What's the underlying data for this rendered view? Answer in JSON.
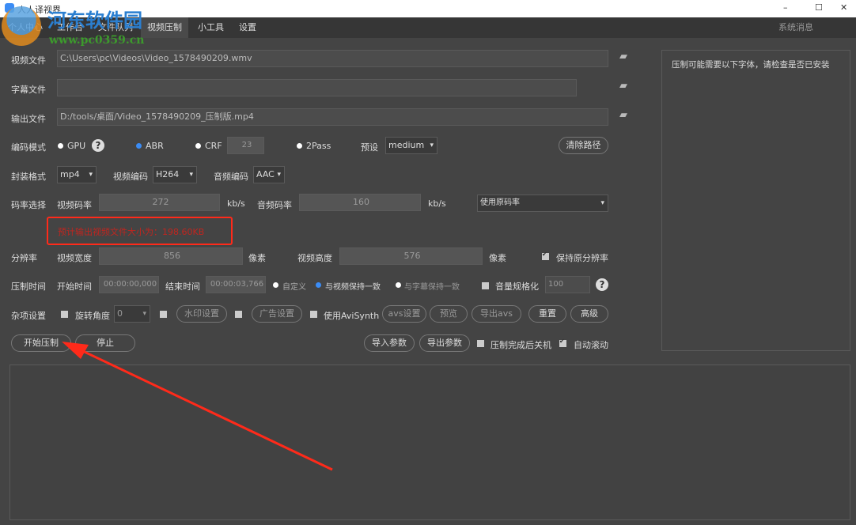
{
  "window": {
    "title": "人人译视界",
    "minimize": "–",
    "maximize": "☐",
    "close": "✕"
  },
  "watermark": {
    "name": "河东软件园",
    "url": "www.pc0359.cn"
  },
  "menu": {
    "items": [
      "个人中心",
      "工作台",
      "文件队列",
      "视频压制",
      "小工具",
      "设置"
    ],
    "system_msg": "系统消息"
  },
  "form": {
    "video_file_label": "视频文件",
    "video_file": "C:\\Users\\pc\\Videos\\Video_1578490209.wmv",
    "subtitle_label": "字幕文件",
    "subtitle_file": "",
    "output_label": "输出文件",
    "output_file": "D:/tools/桌面/Video_1578490209_压制版.mp4",
    "encode_mode_label": "编码模式",
    "gpu": "GPU",
    "abr": "ABR",
    "crf": "CRF",
    "crf_value": "23",
    "twopass": "2Pass",
    "preset_label": "预设",
    "preset": "medium",
    "clear_path": "清除路径",
    "container_label": "封装格式",
    "container": "mp4",
    "vcodec_label": "视频编码",
    "vcodec": "H264",
    "acodec_label": "音频编码",
    "acodec": "AAC",
    "bitrate_label": "码率选择",
    "vbitrate_label": "视频码率",
    "vbitrate": "272",
    "kbs": "kb/s",
    "abitrate_label": "音频码率",
    "abitrate": "160",
    "bitrate_mode": "使用原码率",
    "estimate": "预计输出视频文件大小为：198.60KB",
    "resolution_label": "分辨率",
    "width_label": "视频宽度",
    "width": "856",
    "pixel": "像素",
    "height_label": "视频高度",
    "height": "576",
    "keep_res": "保持原分辨率",
    "time_label": "压制时间",
    "start_label": "开始时间",
    "start": "00:00:00,000",
    "end_label": "结束时间",
    "end": "00:00:03,766",
    "custom": "自定义",
    "same_video": "与视频保持一致",
    "same_sub": "与字幕保持一致",
    "normalize": "音量规格化",
    "volume": "100",
    "misc_label": "杂项设置",
    "rotate_label": "旋转角度",
    "rotate": "0",
    "watermark_btn": "水印设置",
    "ad_btn": "广告设置",
    "avisynth": "使用AviSynth",
    "avs_btn": "avs设置",
    "preview_btn": "预览",
    "export_avs": "导出avs",
    "reset": "重置",
    "advanced": "高级",
    "start_btn": "开始压制",
    "stop_btn": "停止",
    "import_params": "导入参数",
    "export_params": "导出参数",
    "shutdown": "压制完成后关机",
    "autoscroll": "自动滚动"
  },
  "side_panel": {
    "text": "压制可能需要以下字体，请检查是否已安装"
  },
  "colors": {
    "accent": "#3b8cf5",
    "warning": "#c0251f",
    "annotation": "#ff2a1a"
  }
}
